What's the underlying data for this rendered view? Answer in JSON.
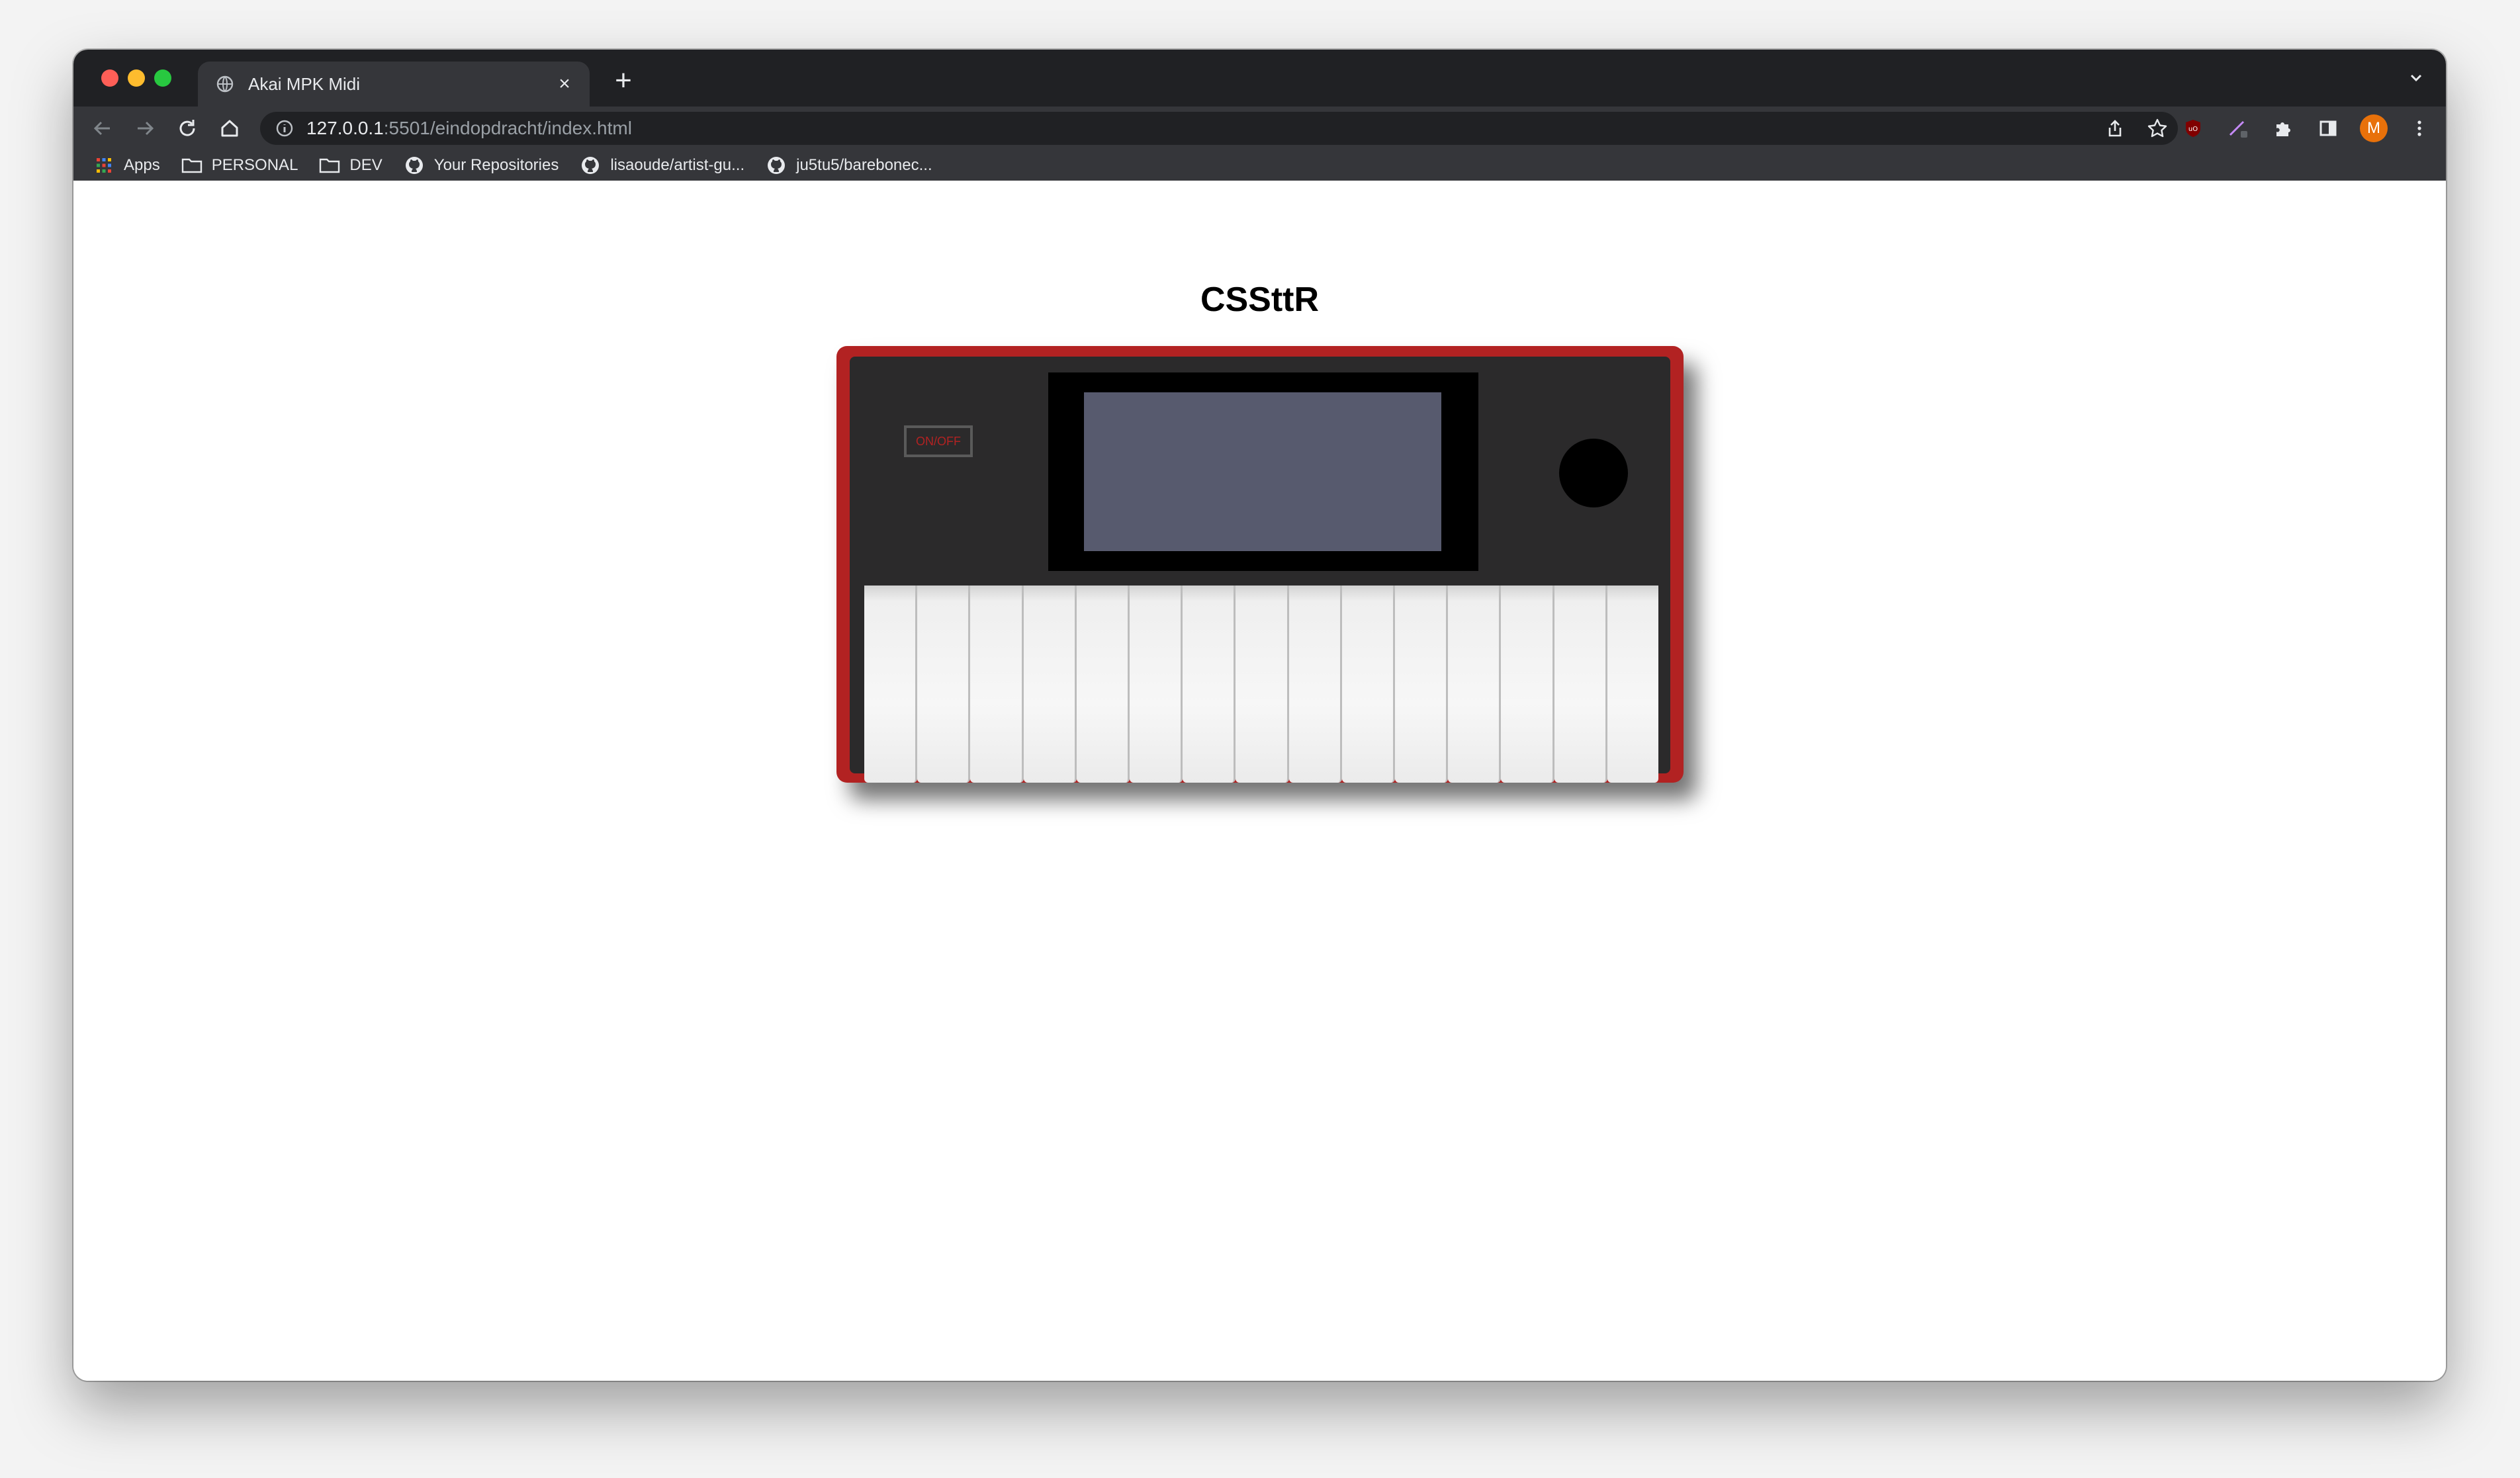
{
  "browser": {
    "tab_title": "Akai MPK Midi",
    "tab_close": "×",
    "new_tab": "+",
    "url_host": "127.0.0.1",
    "url_path": ":5501/eindopdracht/index.html",
    "avatar_letter": "M",
    "bookmarks": [
      {
        "label": "Apps",
        "icon": "apps-grid-icon"
      },
      {
        "label": "PERSONAL",
        "icon": "folder-icon"
      },
      {
        "label": "DEV",
        "icon": "folder-icon"
      },
      {
        "label": "Your Repositories",
        "icon": "github-icon"
      },
      {
        "label": "lisaoude/artist-gu...",
        "icon": "github-icon"
      },
      {
        "label": "ju5tu5/barebonec...",
        "icon": "github-icon"
      }
    ]
  },
  "page": {
    "title": "CSSttR",
    "onoff_label": "ON/OFF",
    "white_key_count": 15
  },
  "colors": {
    "keyboard_body": "#b22222",
    "panel": "#2b2a2b",
    "screen": "#575a6e",
    "chrome_dark": "#202124",
    "chrome_toolbar": "#35363a",
    "avatar": "#e8710a"
  }
}
